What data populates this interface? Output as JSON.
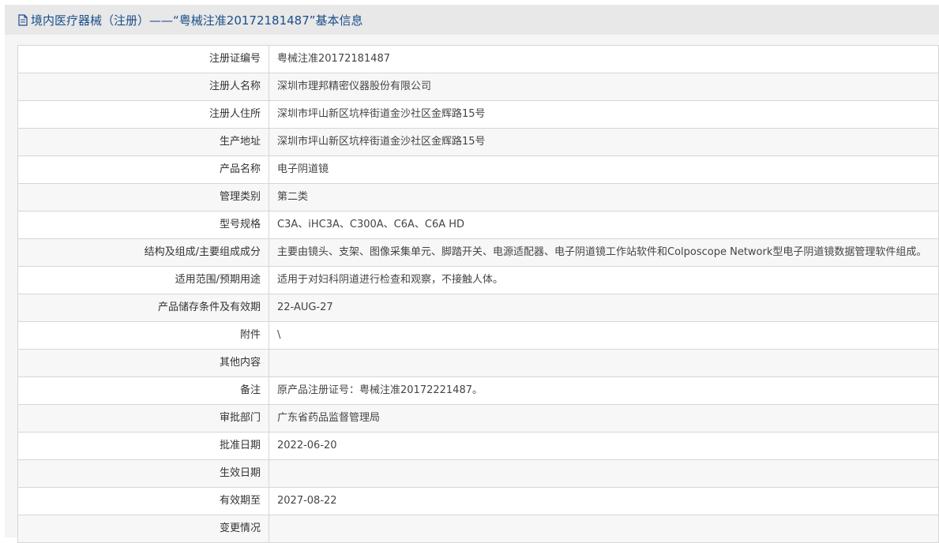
{
  "header": {
    "title": "境内医疗器械（注册）——“粤械注准20172181487”基本信息"
  },
  "rows": [
    {
      "label": "注册证编号",
      "value": "粤械注准20172181487"
    },
    {
      "label": "注册人名称",
      "value": "深圳市理邦精密仪器股份有限公司"
    },
    {
      "label": "注册人住所",
      "value": "深圳市坪山新区坑梓街道金沙社区金辉路15号"
    },
    {
      "label": "生产地址",
      "value": "深圳市坪山新区坑梓街道金沙社区金辉路15号"
    },
    {
      "label": "产品名称",
      "value": "电子阴道镜"
    },
    {
      "label": "管理类别",
      "value": "第二类"
    },
    {
      "label": "型号规格",
      "value": "C3A、iHC3A、C300A、C6A、C6A HD"
    },
    {
      "label": "结构及组成/主要组成成分",
      "value": "主要由镜头、支架、图像采集单元、脚踏开关、电源适配器、电子阴道镜工作站软件和Colposcope Network型电子阴道镜数据管理软件组成。"
    },
    {
      "label": "适用范围/预期用途",
      "value": "适用于对妇科阴道进行检查和观察，不接触人体。"
    },
    {
      "label": "产品储存条件及有效期",
      "value": "22-AUG-27"
    },
    {
      "label": "附件",
      "value": "\\"
    },
    {
      "label": "其他内容",
      "value": ""
    },
    {
      "label": "备注",
      "value": "原产品注册证号：粤械注准20172221487。"
    },
    {
      "label": "审批部门",
      "value": "广东省药品监督管理局"
    },
    {
      "label": "批准日期",
      "value": "2022-06-20"
    },
    {
      "label": "生效日期",
      "value": ""
    },
    {
      "label": "有效期至",
      "value": "2027-08-22"
    },
    {
      "label": "变更情况",
      "value": ""
    }
  ]
}
